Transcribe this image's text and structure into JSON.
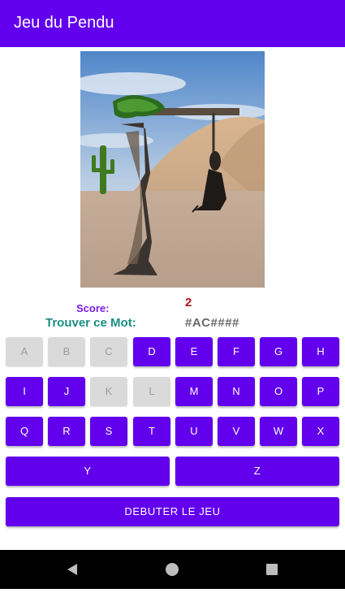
{
  "app_bar": {
    "title": "Jeu du Pendu"
  },
  "status": {
    "score_label": "Score:",
    "score_value": "2",
    "word_label": "Trouver ce Mot:",
    "word_value": "#AC####"
  },
  "keyboard": {
    "rows": [
      [
        {
          "letter": "A",
          "enabled": false
        },
        {
          "letter": "B",
          "enabled": false
        },
        {
          "letter": "C",
          "enabled": false
        },
        {
          "letter": "D",
          "enabled": true
        },
        {
          "letter": "E",
          "enabled": true
        },
        {
          "letter": "F",
          "enabled": true
        },
        {
          "letter": "G",
          "enabled": true
        },
        {
          "letter": "H",
          "enabled": true
        }
      ],
      [
        {
          "letter": "I",
          "enabled": true
        },
        {
          "letter": "J",
          "enabled": true
        },
        {
          "letter": "K",
          "enabled": false
        },
        {
          "letter": "L",
          "enabled": false
        },
        {
          "letter": "M",
          "enabled": true
        },
        {
          "letter": "N",
          "enabled": true
        },
        {
          "letter": "O",
          "enabled": true
        },
        {
          "letter": "P",
          "enabled": true
        }
      ],
      [
        {
          "letter": "Q",
          "enabled": true
        },
        {
          "letter": "R",
          "enabled": true
        },
        {
          "letter": "S",
          "enabled": true
        },
        {
          "letter": "T",
          "enabled": true
        },
        {
          "letter": "U",
          "enabled": true
        },
        {
          "letter": "V",
          "enabled": true
        },
        {
          "letter": "W",
          "enabled": true
        },
        {
          "letter": "X",
          "enabled": true
        }
      ]
    ],
    "y_label": "Y",
    "z_label": "Z"
  },
  "start_button": {
    "label": "DEBUTER LE JEU"
  },
  "colors": {
    "primary": "#6200ee",
    "disabled": "#dadada",
    "score_label": "#7a1be0",
    "score_value": "#b3121b",
    "word_label": "#1a8f83"
  },
  "nav_icons": [
    "back-icon",
    "home-icon",
    "recents-icon"
  ]
}
